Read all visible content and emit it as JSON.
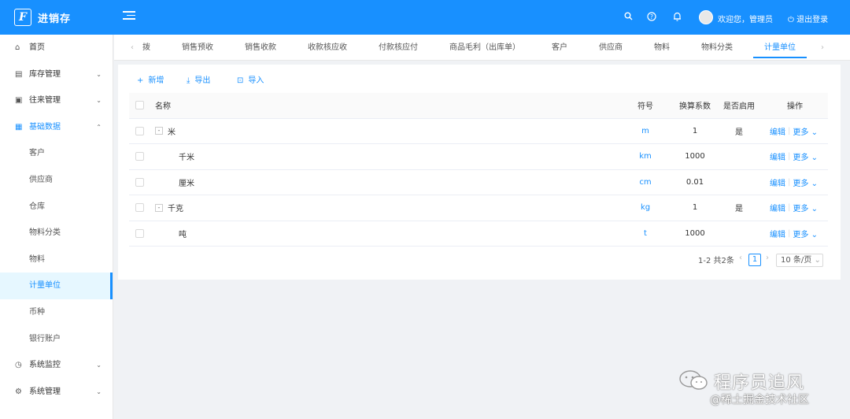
{
  "header": {
    "logo_letter": "F",
    "app_title": "进销存",
    "welcome": "欢迎您，管理员",
    "logout": "退出登录",
    "accent": "#1890ff"
  },
  "sidebar": {
    "items": [
      {
        "label": "首页",
        "icon": "home-icon"
      },
      {
        "label": "库存管理",
        "icon": "inventory-icon",
        "arrow": "⌄"
      },
      {
        "label": "往来管理",
        "icon": "exchange-icon",
        "arrow": "⌄"
      },
      {
        "label": "基础数据",
        "icon": "grid-icon",
        "arrow": "⌃"
      }
    ],
    "sub_items": [
      "客户",
      "供应商",
      "仓库",
      "物料分类",
      "物料",
      "计量单位",
      "币种",
      "银行账户"
    ],
    "bottom_items": [
      {
        "label": "系统监控",
        "icon": "monitor-icon",
        "arrow": "⌄"
      },
      {
        "label": "系统管理",
        "icon": "settings-icon",
        "arrow": "⌄"
      }
    ]
  },
  "tabs": [
    "拨",
    "销售预收",
    "销售收款",
    "收款核应收",
    "付款核应付",
    "商品毛利（出库单）",
    "客户",
    "供应商",
    "物料",
    "物料分类",
    "计量单位"
  ],
  "toolbar": {
    "add": "新增",
    "export": "导出",
    "import": "导入"
  },
  "table": {
    "headers": {
      "name": "名称",
      "symbol": "符号",
      "factor": "换算系数",
      "enabled": "是否启用",
      "ops": "操作"
    },
    "rows": [
      {
        "name": "米",
        "symbol": "m",
        "factor": "1",
        "enabled": "是",
        "level": 0,
        "expander": "-"
      },
      {
        "name": "千米",
        "symbol": "km",
        "factor": "1000",
        "enabled": "",
        "level": 1,
        "expander": ""
      },
      {
        "name": "厘米",
        "symbol": "cm",
        "factor": "0.01",
        "enabled": "",
        "level": 1,
        "expander": ""
      },
      {
        "name": "千克",
        "symbol": "kg",
        "factor": "1",
        "enabled": "是",
        "level": 0,
        "expander": "-"
      },
      {
        "name": "吨",
        "symbol": "t",
        "factor": "1000",
        "enabled": "",
        "level": 1,
        "expander": ""
      }
    ],
    "edit": "编辑",
    "more": "更多"
  },
  "pagination": {
    "total": "1-2 共2条",
    "page": "1",
    "page_size": "10 条/页"
  },
  "watermark": {
    "line1": "程序员追风",
    "line2": "@稀土掘金技术社区"
  }
}
